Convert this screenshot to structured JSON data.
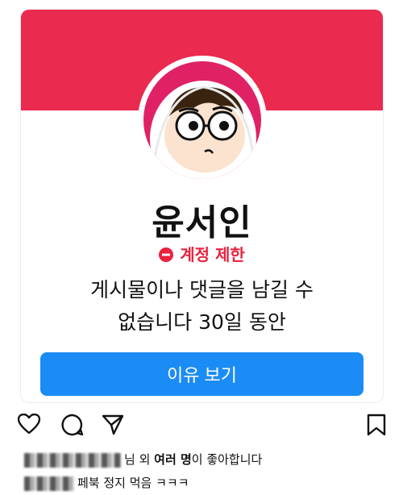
{
  "profile": {
    "name": "윤서인",
    "restriction_label": "계정 제한",
    "description_line1": "게시물이나 댓글을 남길 수",
    "description_line2": "없습니다 30일 동안",
    "button_label": "이유 보기"
  },
  "colors": {
    "banner": "#ea2a4f",
    "restriction": "#e8223f",
    "button": "#1b8cf5"
  },
  "post_actions": {
    "icons": [
      "heart-icon",
      "comment-icon",
      "share-icon",
      "bookmark-icon"
    ]
  },
  "likes": {
    "suffix_text_1": "님 외 ",
    "bold_text": "여러 명",
    "suffix_text_2": "이 좋아합니다"
  },
  "caption": {
    "text": "페북 정지 먹음 ㅋㅋㅋ"
  }
}
